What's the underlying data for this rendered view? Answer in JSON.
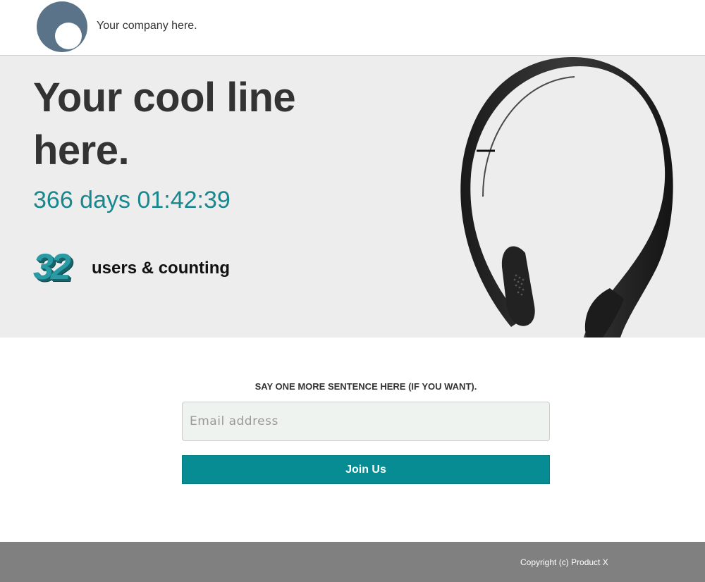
{
  "header": {
    "company_text": "Your company here.",
    "logo_icon": "circle-logo-icon"
  },
  "hero": {
    "headline": "Your cool line here.",
    "countdown": "366 days 01:42:39",
    "user_count": "32",
    "user_count_label": "users & counting",
    "product_image": "headphones-headband-image"
  },
  "signup": {
    "heading": "SAY ONE MORE SENTENCE HERE (IF YOU WANT).",
    "email_placeholder": "Email address",
    "email_value": "",
    "join_label": "Join Us"
  },
  "footer": {
    "copyright": "Copyright (c) Product X"
  },
  "colors": {
    "accent": "#068c92",
    "countdown": "#19878e",
    "hero_bg": "#ededed",
    "footer_bg": "#808080",
    "logo": "#5a7389"
  }
}
